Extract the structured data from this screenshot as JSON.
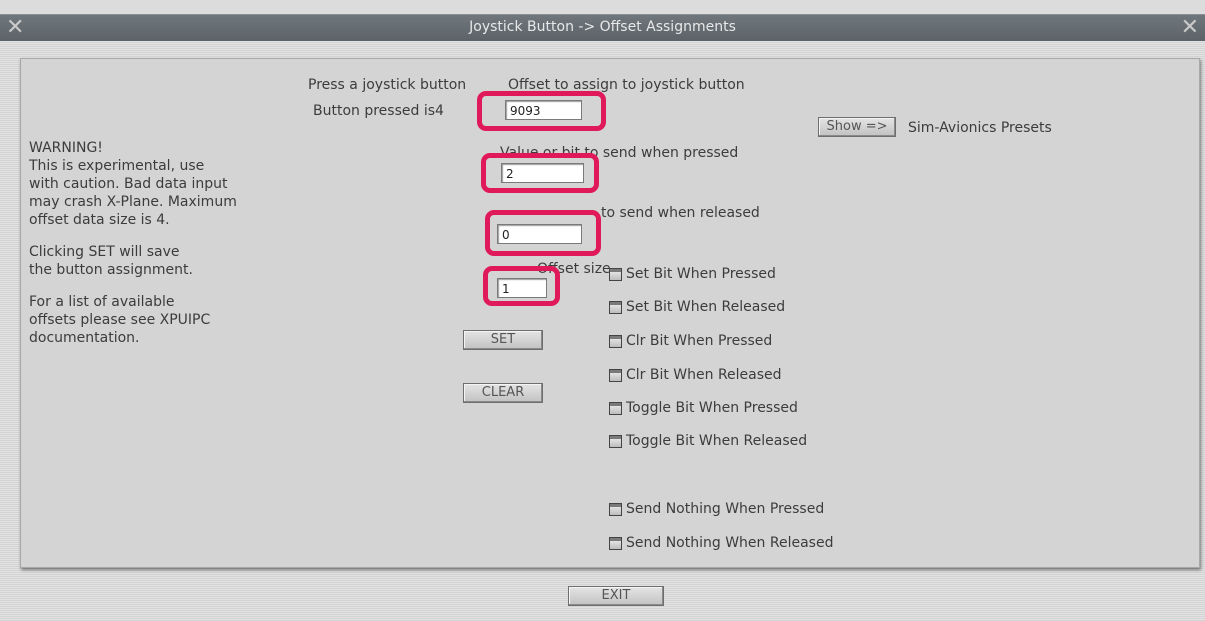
{
  "window": {
    "title": "Joystick Button -> Offset Assignments",
    "close_glyph": "✕"
  },
  "labels": {
    "press_button": "Press a joystick button",
    "button_pressed": "Button pressed is4",
    "offset_assign": "Offset to assign to joystick button",
    "value_pressed": "Value or bit to send when pressed",
    "value_released": "to send when released",
    "offset_size": "Offset size",
    "sim_avionics": "Sim-Avionics Presets"
  },
  "warning": {
    "text1": "WARNING!\nThis is experimental, use\nwith caution. Bad data input\nmay crash X-Plane. Maximum\noffset data size is 4.",
    "text2": "Clicking SET will save\nthe button assignment.",
    "text3": "For a list of available\noffsets please see XPUIPC\ndocumentation."
  },
  "fields": {
    "offset_value": "9093",
    "pressed_value": "2",
    "released_value": "0",
    "size_value": "1"
  },
  "buttons": {
    "show": "Show =>",
    "set": "SET",
    "clear": "CLEAR",
    "exit": "EXIT"
  },
  "checkboxes": [
    {
      "label": "Set Bit When Pressed",
      "checked": false
    },
    {
      "label": "Set Bit When Released",
      "checked": false
    },
    {
      "label": "Clr Bit When Pressed",
      "checked": false
    },
    {
      "label": "Clr Bit When Released",
      "checked": false
    },
    {
      "label": "Toggle Bit When Pressed",
      "checked": false
    },
    {
      "label": "Toggle Bit When Released",
      "checked": false
    },
    {
      "label": "Send Nothing When Pressed",
      "checked": false
    },
    {
      "label": "Send Nothing When Released",
      "checked": false
    }
  ],
  "colors": {
    "highlight": "#e0195a",
    "titlebar": "#62696f"
  }
}
